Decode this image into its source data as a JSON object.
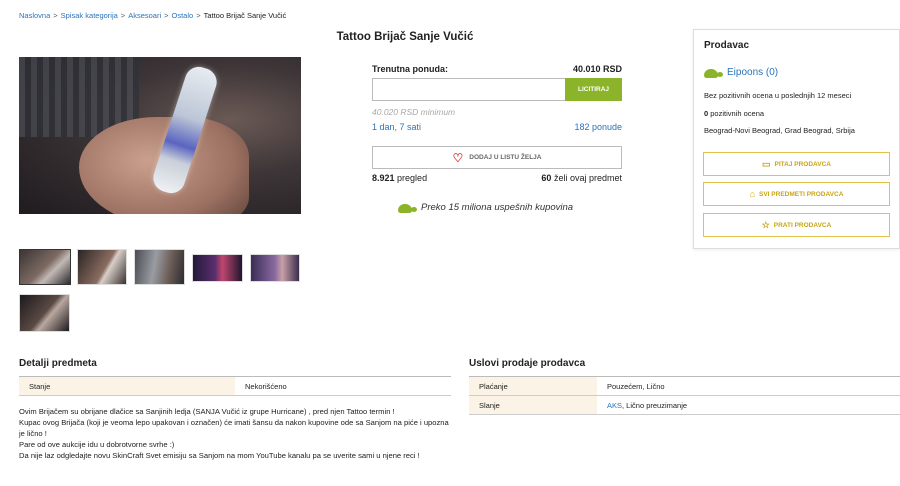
{
  "breadcrumb": {
    "items": [
      "Naslovna",
      "Spisak kategorija",
      "Aksesoari",
      "Ostalo"
    ],
    "current": "Tattoo Brijač Sanje Vučić"
  },
  "item": {
    "title": "Tattoo Brijač Sanje Vučić"
  },
  "bid": {
    "label": "Trenutna ponuda:",
    "current_price": "40.010 RSD",
    "input_placeholder": "",
    "button_label": "LICITIRAJ",
    "minimum": "40.020 RSD minimum",
    "time_left": "1 dan, 7 sati",
    "bids_count": "182 ponude",
    "wishlist_label": "DODAJ U LISTU ŽELJA",
    "views_value": "8.921",
    "views_label": "pregled",
    "wants_value": "60",
    "wants_label": "želi ovaj predmet",
    "promo_text": "Preko 15 miliona uspešnih kupovina"
  },
  "seller": {
    "heading": "Prodavac",
    "name": "Eipoons (0)",
    "no_ratings": "Bez pozitivnih ocena u poslednjih 12 meseci",
    "positive_value": "0",
    "positive_label": "pozitivnih ocena",
    "location": "Beograd-Novi Beograd, Grad Beograd, Srbija",
    "buttons": {
      "ask": "PITAJ PRODAVCA",
      "all_items": "SVI PREDMETI PRODAVCA",
      "follow": "PRATI PRODAVCA"
    }
  },
  "details": {
    "heading": "Detalji predmeta",
    "rows": [
      {
        "key": "Stanje",
        "value": "Nekorišćeno"
      }
    ],
    "description": [
      "Ovim Brijačem su obrijane dlačice sa Sanjinih ledja (SANJA Vučić iz grupe Hurricane) , pred njen Tattoo termin !",
      "Kupac ovog Brijača (koji je veoma lepo upakovan i označen) će imati šansu da nakon kupovine ode sa Sanjom na piće i upozna je lično !",
      "Pare od ove aukcije idu u dobrotvorne svrhe :)",
      "Da nije laz odgledajte novu SkinCraft Svet emisiju sa Sanjom na mom YouTube kanalu pa se uverite sami u njene reci !"
    ]
  },
  "sale_terms": {
    "heading": "Uslovi prodaje prodavca",
    "payment_key": "Plaćanje",
    "payment_value": "Pouzećem, Lično",
    "shipping_key": "Slanje",
    "shipping_link": "AKS",
    "shipping_rest": ", Lično preuzimanje"
  },
  "icons": {
    "brand_mascot": "turtle-icon",
    "wishlist": "heart-icon",
    "ask": "chat-icon",
    "all_items": "store-icon",
    "follow": "star-icon"
  },
  "colors": {
    "link": "#2a73b8",
    "bid_button": "#8bb42a",
    "seller_button_border": "#e0c24a",
    "seller_button_text": "#c9a515",
    "table_key_bg": "#fbf3e6"
  }
}
